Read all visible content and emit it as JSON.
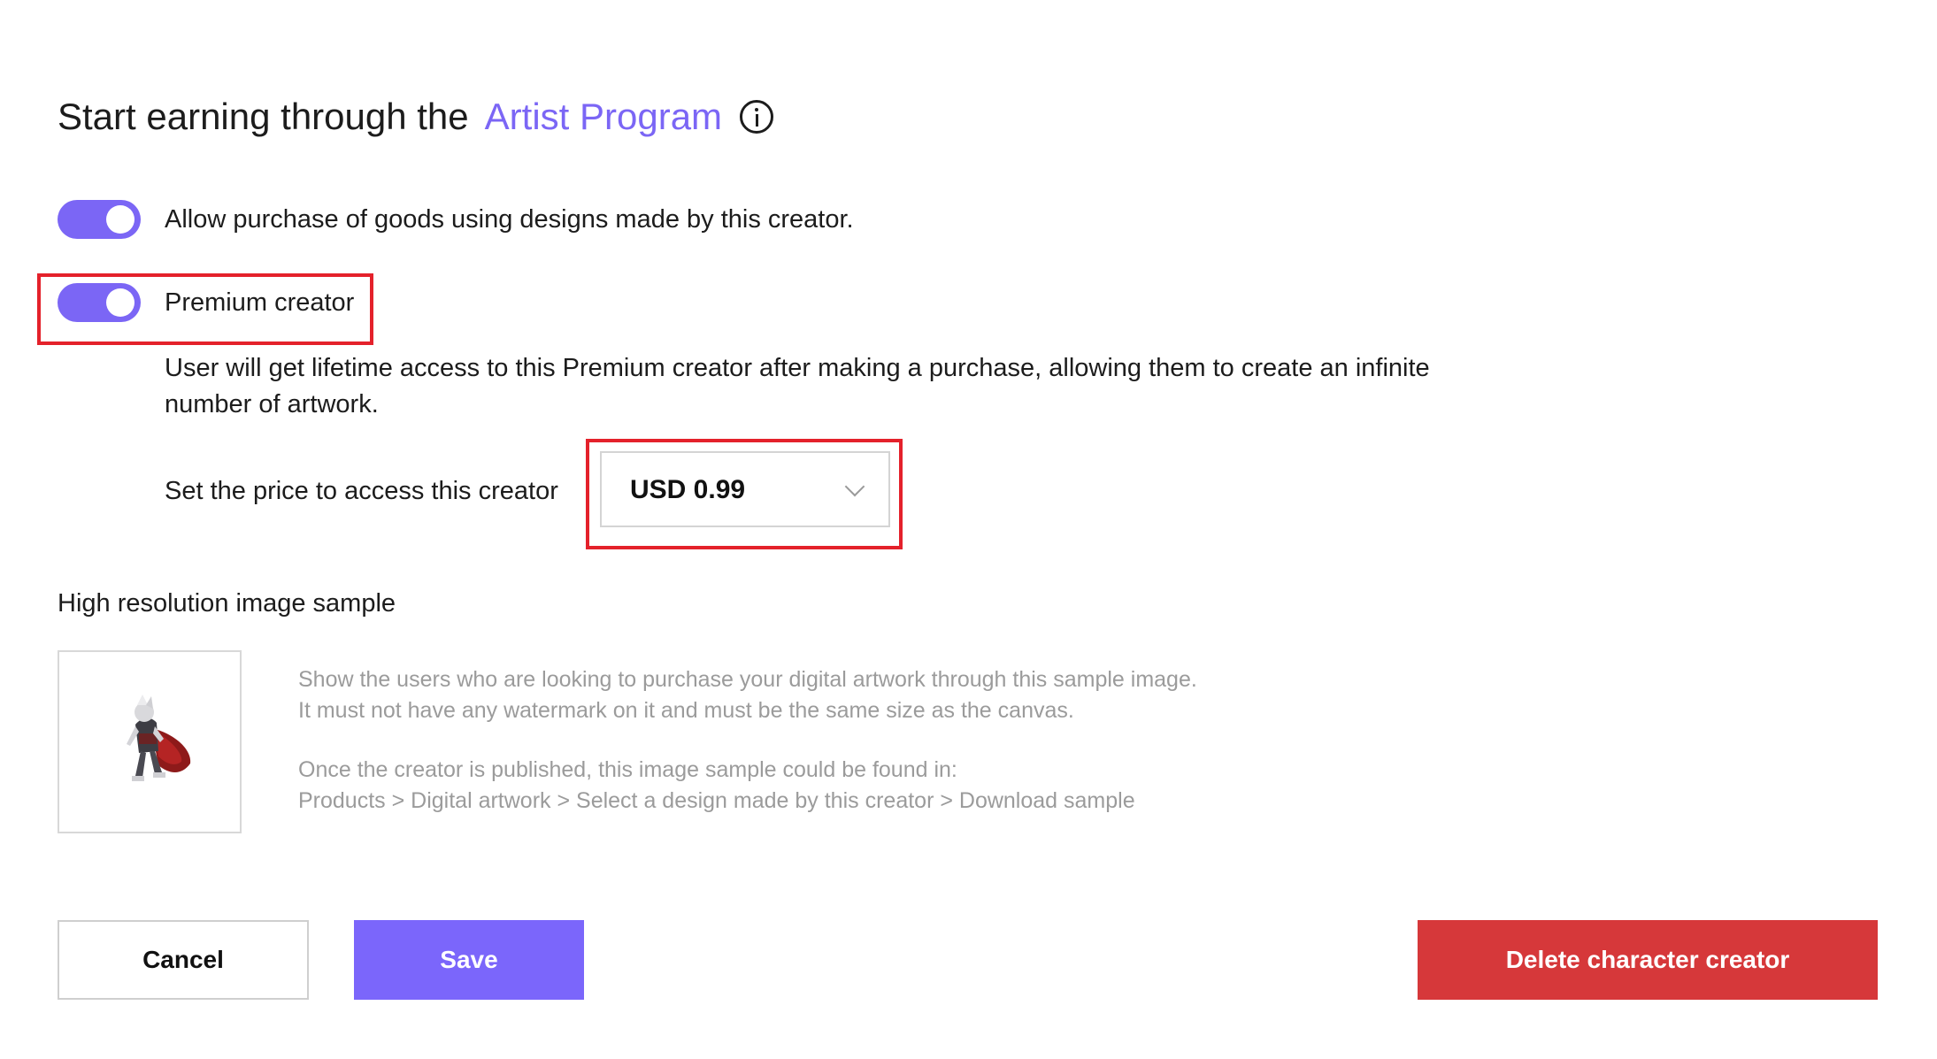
{
  "header": {
    "title_prefix": "Start earning through the",
    "title_link": "Artist Program",
    "info_icon": "info-icon"
  },
  "toggles": [
    {
      "label": "Allow purchase of goods using designs made by this creator.",
      "on": true
    },
    {
      "label": "Premium creator",
      "on": true
    }
  ],
  "premium": {
    "description": "User will get lifetime access to this Premium creator after making a purchase, allowing them to create an infinite number of artwork.",
    "price_label": "Set the price to access this creator",
    "price_value": "USD 0.99"
  },
  "sample": {
    "title": "High resolution image sample",
    "line1": "Show the users who are looking to purchase your digital artwork through this sample image.",
    "line2": "It must not have any watermark on it and must be the same size as the canvas.",
    "line3": "Once the creator is published, this image sample could be found in:",
    "line4": "Products > Digital artwork > Select a design made by this creator > Download sample"
  },
  "buttons": {
    "cancel": "Cancel",
    "save": "Save",
    "delete": "Delete character creator"
  },
  "colors": {
    "accent": "#7b66f5",
    "danger": "#d6383a",
    "highlight": "#e4212b"
  }
}
